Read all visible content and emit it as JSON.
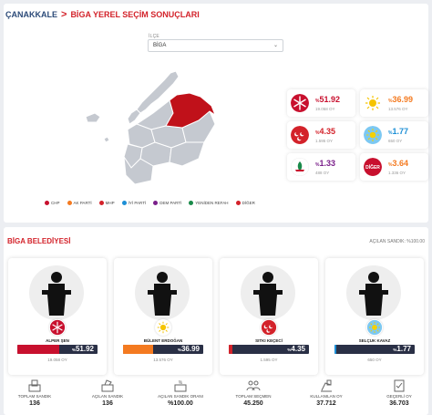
{
  "breadcrumb": {
    "parent": "ÇANAKKALE",
    "separator": ">",
    "current": "BİGA YEREL SEÇİM SONUÇLARI"
  },
  "district_select": {
    "label": "İLÇE",
    "value": "BİGA"
  },
  "legend": [
    {
      "label": "CHP",
      "color": "#c8102e"
    },
    {
      "label": "AK PARTİ",
      "color": "#f47a20"
    },
    {
      "label": "MHP",
      "color": "#d3222a"
    },
    {
      "label": "İYİ PARTİ",
      "color": "#1c8fd6"
    },
    {
      "label": "DEM PARTİ",
      "color": "#7a1f8a"
    },
    {
      "label": "YENİDEN REFAH",
      "color": "#1a8a4a"
    },
    {
      "label": "DİĞER",
      "color": "#d3222a"
    }
  ],
  "party_results": [
    {
      "party": "CHP",
      "prefix": "%",
      "percent": "51.92",
      "votes": "19.058 OY",
      "color": "#c8102e",
      "icon": "chp-logo-icon"
    },
    {
      "party": "AK PARTİ",
      "prefix": "%",
      "percent": "36.99",
      "votes": "13.576 OY",
      "color": "#f47a20",
      "icon": "ak-parti-logo-icon"
    },
    {
      "party": "MHP",
      "prefix": "%",
      "percent": "4.35",
      "votes": "1.595 OY",
      "color": "#d3222a",
      "icon": "mhp-logo-icon"
    },
    {
      "party": "İYİ PARTİ",
      "prefix": "%",
      "percent": "1.77",
      "votes": "650 OY",
      "color": "#1c8fd6",
      "icon": "iyi-parti-logo-icon"
    },
    {
      "party": "YENİDEN REFAH",
      "prefix": "%",
      "percent": "1.33",
      "votes": "488 OY",
      "color": "#7a1f8a",
      "icon": "yeniden-refah-logo-icon"
    },
    {
      "party": "DİĞER",
      "prefix": "%",
      "percent": "3.64",
      "votes": "1.336 OY",
      "color": "#d3222a",
      "icon": "diger-logo-icon",
      "logo_text": "DİĞER"
    }
  ],
  "belediye": {
    "title": "BİGA BELEDİYESİ",
    "opened": "AÇILAN SANDIK: %100.00",
    "candidates": [
      {
        "name": "ALPER ŞEN",
        "prefix": "%",
        "percent": "51.92",
        "share": 51.92,
        "votes": "19.058 OY",
        "color": "#c8102e",
        "icon": "chp-logo-icon"
      },
      {
        "name": "BÜLENT ERDOĞAN",
        "prefix": "%",
        "percent": "36.99",
        "share": 36.99,
        "votes": "13.576 OY",
        "color": "#f47a20",
        "icon": "ak-parti-logo-icon"
      },
      {
        "name": "SITKI KEÇECİ",
        "prefix": "%",
        "percent": "4.35",
        "share": 4.35,
        "votes": "1.595 OY",
        "color": "#d3222a",
        "icon": "mhp-logo-icon"
      },
      {
        "name": "SELÇUK KAVAZ",
        "prefix": "%",
        "percent": "1.77",
        "share": 1.77,
        "votes": "650 OY",
        "color": "#1c8fd6",
        "icon": "iyi-parti-logo-icon"
      }
    ],
    "stats": [
      {
        "label": "TOPLAM SANDIK",
        "value": "136",
        "icon": "ballot-box-icon"
      },
      {
        "label": "AÇILAN SANDIK",
        "value": "136",
        "icon": "open-ballot-box-icon"
      },
      {
        "label": "AÇILAN SANDIK ORANI",
        "value": "%100.00",
        "icon": "percentage-icon"
      },
      {
        "label": "TOPLAM SEÇMEN",
        "value": "45.250",
        "icon": "voters-icon"
      },
      {
        "label": "KULLANILAN OY",
        "value": "37.712",
        "icon": "cast-vote-icon"
      },
      {
        "label": "GEÇERLİ OY",
        "value": "36.703",
        "icon": "valid-vote-icon"
      }
    ]
  }
}
